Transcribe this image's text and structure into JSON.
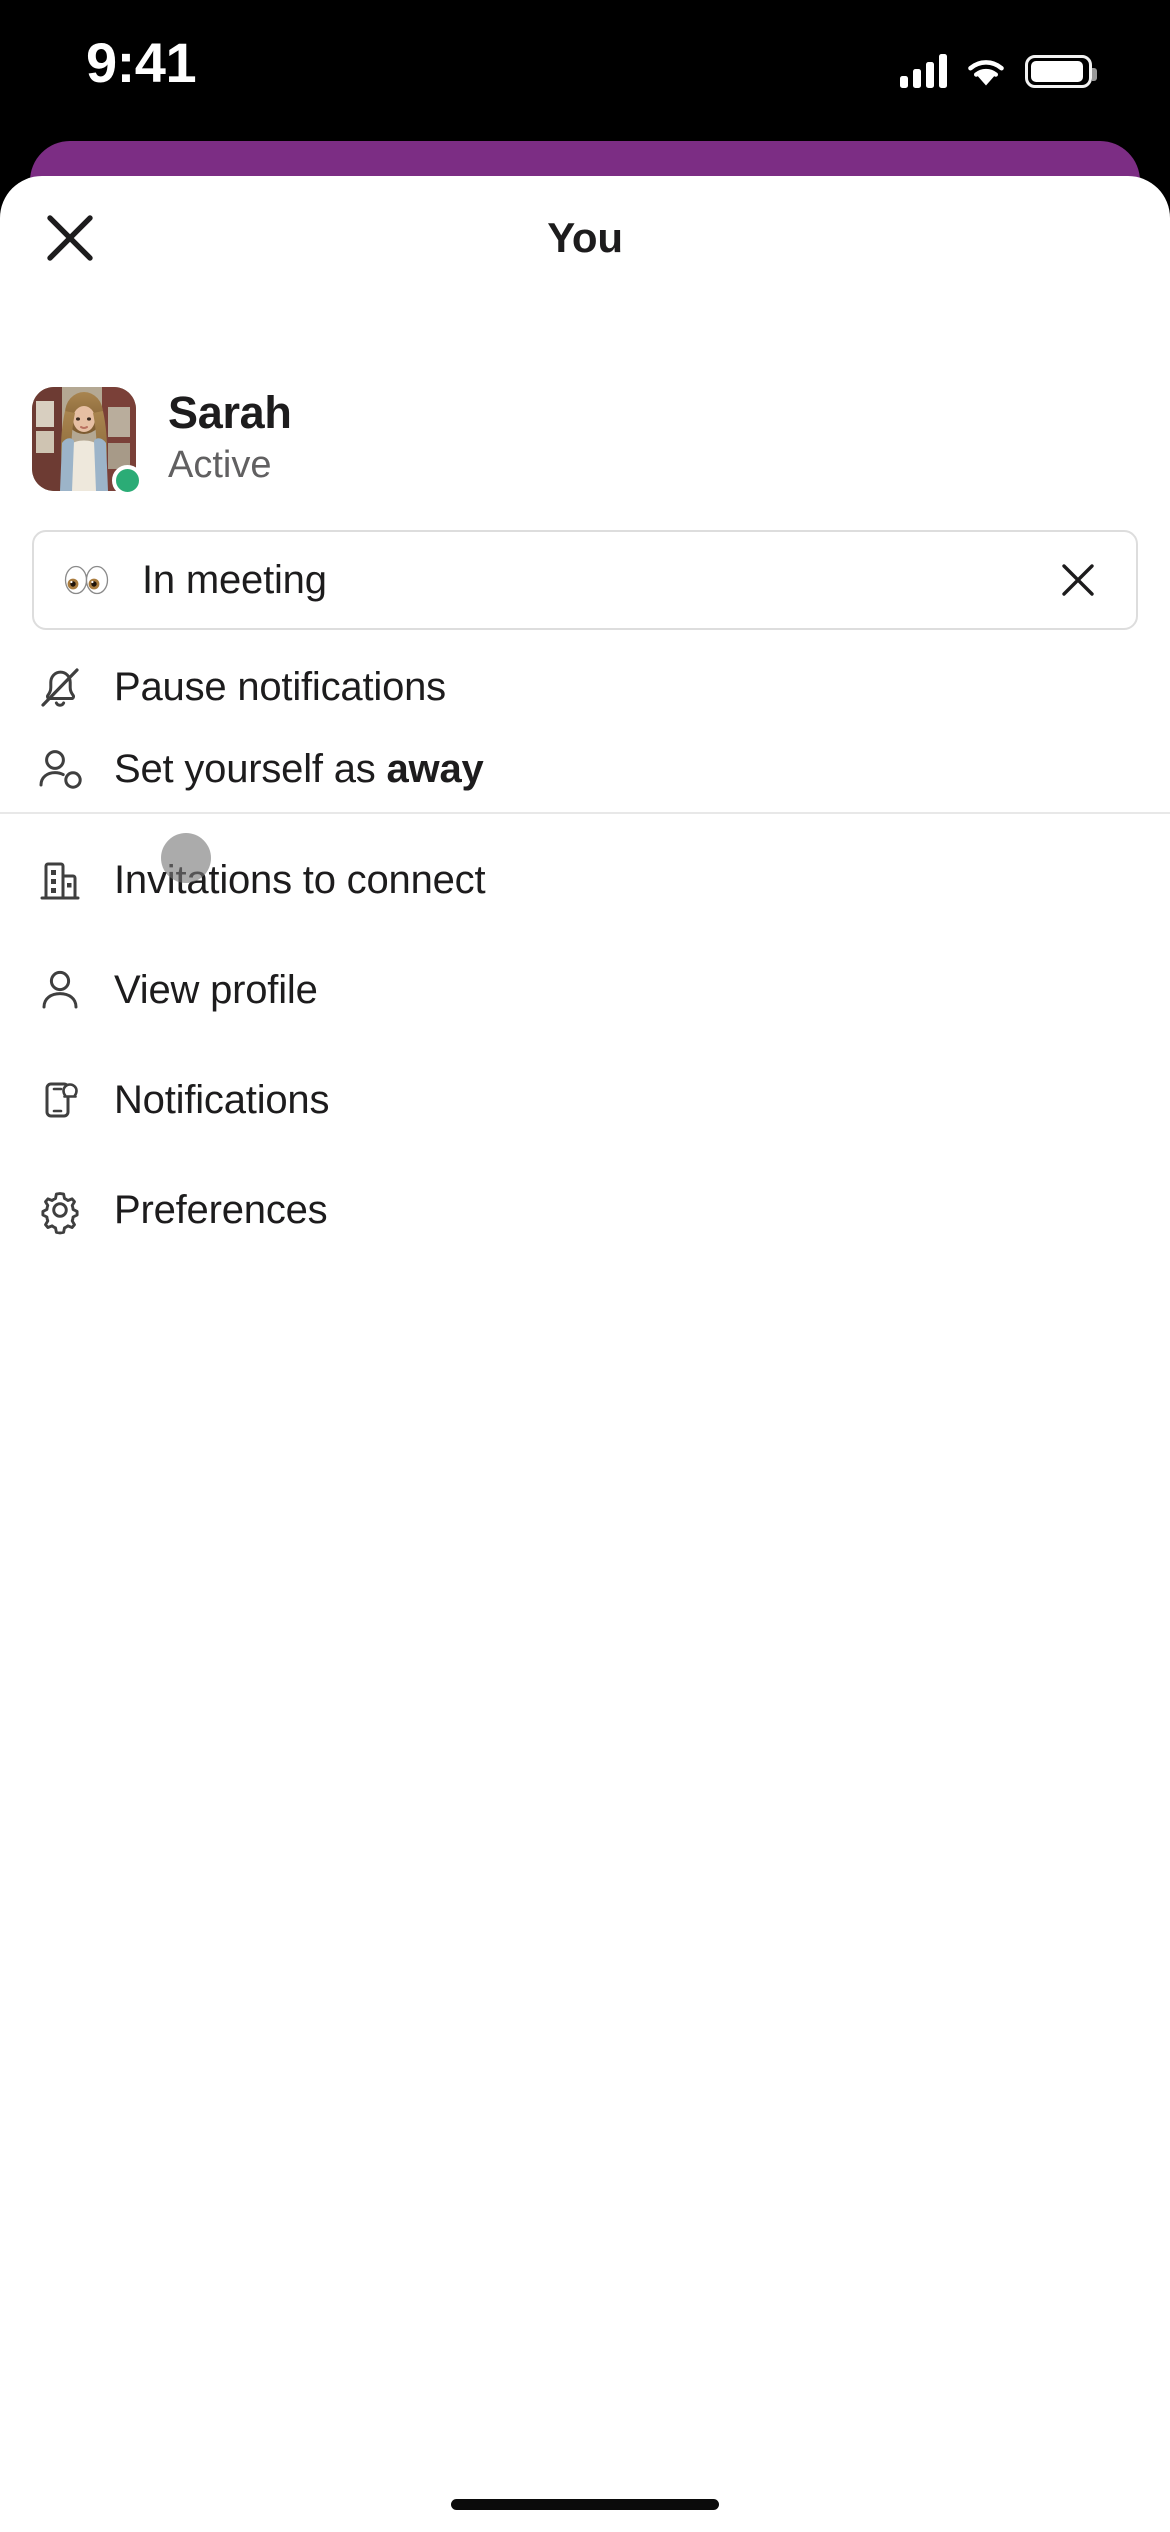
{
  "status_bar": {
    "time": "9:41",
    "signal_icon": "cellular-bars-icon",
    "wifi_icon": "wifi-icon",
    "battery_icon": "battery-icon"
  },
  "theme": {
    "brand_purple": "#7C2D84",
    "sheet_background": "#FFFFFF",
    "text_primary": "#1D1C1D",
    "text_secondary": "#616061",
    "presence_active": "#2BAC76",
    "border": "#DDDDDD"
  },
  "header": {
    "title": "You",
    "close_label": "Close"
  },
  "profile": {
    "name": "Sarah",
    "presence": "Active",
    "avatar_alt": "Sarah profile photo"
  },
  "status_field": {
    "emoji": "eyes",
    "text": "In meeting",
    "clear_label": "Clear status"
  },
  "menu": {
    "group_primary": [
      {
        "icon": "bell-slash-icon",
        "label": "Pause notifications"
      },
      {
        "icon": "person-away-icon",
        "label_prefix": "Set yourself as ",
        "label_bold": "away"
      }
    ],
    "group_secondary": [
      {
        "icon": "building-icon",
        "label": "Invitations to connect"
      },
      {
        "icon": "person-icon",
        "label": "View profile"
      },
      {
        "icon": "mobile-bell-icon",
        "label": "Notifications"
      },
      {
        "icon": "gear-icon",
        "label": "Preferences"
      }
    ]
  },
  "system": {
    "home_indicator": "home-indicator"
  }
}
